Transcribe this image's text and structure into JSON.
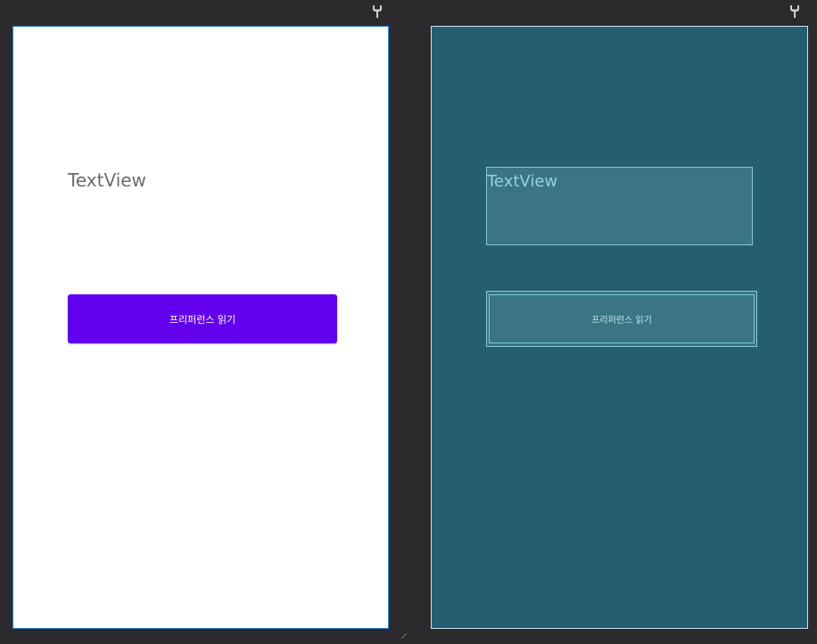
{
  "design": {
    "textview_text": "TextView",
    "button_label": "프리퍼런스 읽기"
  },
  "blueprint": {
    "textview_text": "TextView",
    "button_label": "프리퍼런스 읽기"
  },
  "icons": {
    "left_toolbar": "wrench-icon",
    "right_toolbar": "wrench-icon"
  },
  "colors": {
    "canvas_background": "#2b2b2d",
    "design_background": "#ffffff",
    "design_border": "#2f7fd8",
    "design_button": "#6200ee",
    "blueprint_background": "#245e70",
    "blueprint_outline": "#7fcad9"
  }
}
